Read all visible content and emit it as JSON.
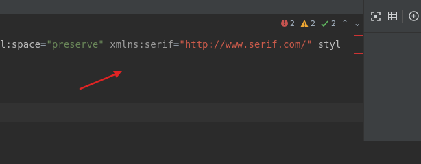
{
  "inspections": {
    "errors": "2",
    "warnings": "2",
    "weak_warnings": "2",
    "prev_icon": "chevron-up",
    "next_icon": "chevron-down",
    "colors": {
      "error": "#c75450",
      "warning": "#f0a732",
      "ok": "#5fb55f"
    }
  },
  "code": {
    "tokens": [
      {
        "text": "l:space",
        "class": "tok-attr"
      },
      {
        "text": "=",
        "class": "tok-eq"
      },
      {
        "text": "\"preserve\"",
        "class": "tok-str-green"
      },
      {
        "text": " ",
        "class": "tok-eq"
      },
      {
        "text": "xmlns:serif",
        "class": "tok-attr-dim"
      },
      {
        "text": "=",
        "class": "tok-eq"
      },
      {
        "text": "\"http://www.serif.com/\"",
        "class": "tok-str-red"
      },
      {
        "text": " styl",
        "class": "tok-attr"
      }
    ]
  },
  "right_toolbar": {
    "fit_icon": "fit-screen",
    "grid_icon": "grid",
    "add_icon": "plus-circle"
  },
  "colors": {
    "editor_bg": "#2b2b2b",
    "panel_bg": "#3c3f41",
    "annotation_arrow": "#e02424"
  }
}
